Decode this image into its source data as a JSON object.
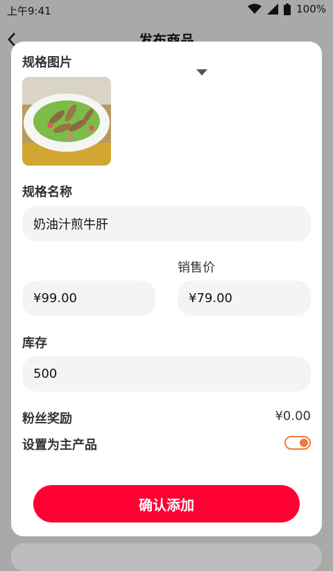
{
  "status_bar": {
    "time": "上午9:41",
    "battery": "100%"
  },
  "header": {
    "title": "发布商品",
    "back_icon": "chevron-left-icon"
  },
  "modal": {
    "spec_image_label": "规格图片",
    "dropdown_icon": "caret-down-icon",
    "spec_name_label": "规格名称",
    "spec_name_value": "奶油汁煎牛肝",
    "sale_price_label": "销售价",
    "original_price_value": "¥99.00",
    "sale_price_value": "¥79.00",
    "stock_label": "库存",
    "stock_value": "500",
    "fan_reward_label": "粉丝奖励",
    "fan_reward_value": "¥0.00",
    "main_product_label": "设置为主产品",
    "main_product_toggle_on": true,
    "confirm_label": "确认添加"
  },
  "colors": {
    "accent": "#ff0033",
    "toggle": "#f07a3c",
    "overlay": "#a9a9a9",
    "field_bg": "#f4f4f4"
  }
}
